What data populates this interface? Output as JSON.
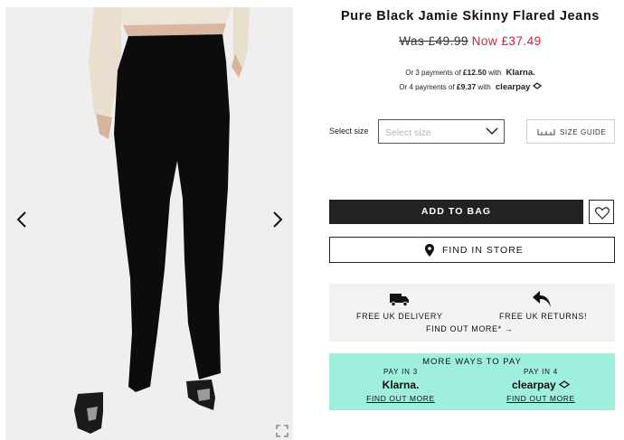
{
  "product": {
    "title": "Pure Black Jamie Skinny Flared Jeans",
    "price_was": "Was £49.99",
    "price_now": "Now £37.49"
  },
  "installments": {
    "klarna_prefix": "Or 3 payments of",
    "klarna_amount": "£12.50",
    "klarna_with": "with",
    "klarna_brand": "Klarna.",
    "clearpay_prefix": "Or 4 payments of",
    "clearpay_amount": "£9.37",
    "clearpay_with": "with",
    "clearpay_brand": "clearpay"
  },
  "size": {
    "label": "Select size",
    "placeholder": "Select size",
    "guide_label": "SIZE GUIDE"
  },
  "actions": {
    "add_to_bag": "ADD TO BAG",
    "find_in_store": "FIND IN STORE"
  },
  "delivery": {
    "free_delivery": "FREE UK DELIVERY",
    "free_returns": "FREE UK RETURNS!",
    "find_out_more": "FIND OUT MORE*  →"
  },
  "ways_to_pay": {
    "heading": "MORE WAYS TO PAY",
    "klarna_pay_in": "PAY IN 3",
    "klarna_logo": "Klarna.",
    "klarna_more": "FIND OUT MORE",
    "clearpay_pay_in": "PAY IN 4",
    "clearpay_logo": "clearpay",
    "clearpay_more": "FIND OUT MORE"
  },
  "colors": {
    "sale_red": "#e3193b",
    "ways_bg": "#9ef0dd",
    "button_dark": "#222222"
  }
}
